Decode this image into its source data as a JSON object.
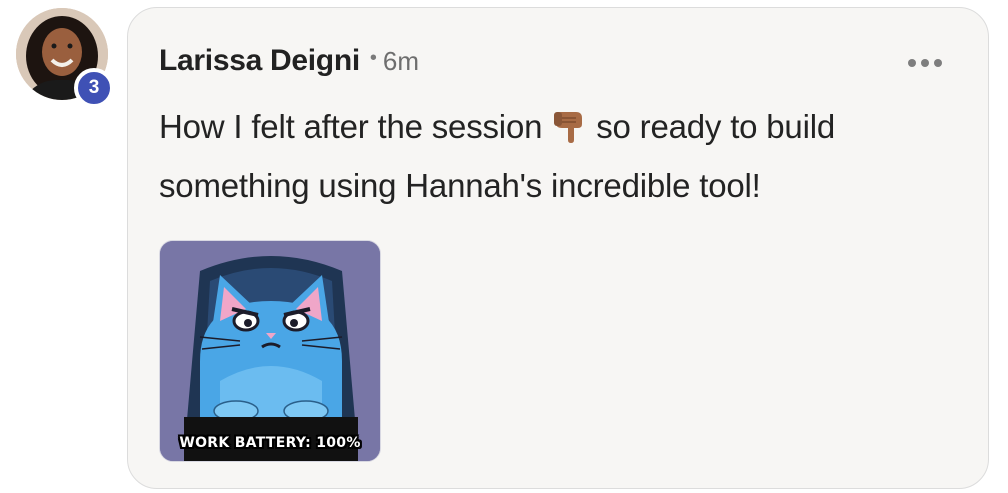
{
  "post": {
    "author": "Larissa Deigni",
    "separator": "•",
    "time": "6m",
    "badge_count": "3",
    "text_before_emoji": "How I felt after the session",
    "emoji_icon": "backhand-index-pointing-down-icon",
    "text_after_emoji": "so ready to build something using Hannah's incredible tool!",
    "more_icon": "more-horizontal-icon"
  },
  "gif": {
    "caption": "WORK BATTERY: 100%",
    "icon": "grumpy-cat-at-laptop"
  },
  "colors": {
    "badge": "#3f51b5",
    "card_background": "#f7f6f4",
    "card_border": "#dcdcdc",
    "text": "#232323",
    "muted": "#6e6e6e"
  }
}
